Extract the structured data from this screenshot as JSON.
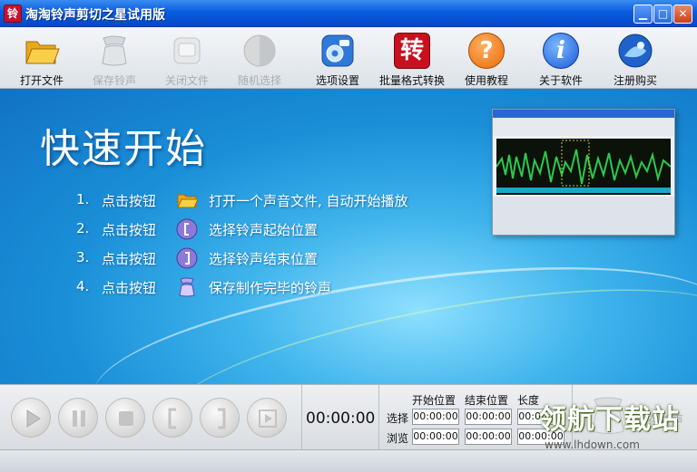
{
  "window": {
    "title": "淘淘铃声剪切之星试用版",
    "app_icon_glyph": "铃",
    "min_glyph": "▁",
    "max_glyph": "□",
    "close_glyph": "✕"
  },
  "toolbar": {
    "items": [
      {
        "label": "打开文件",
        "icon": "folder-open-icon",
        "enabled": true
      },
      {
        "label": "保存铃声",
        "icon": "save-ringtone-icon",
        "enabled": false
      },
      {
        "label": "关闭文件",
        "icon": "close-file-icon",
        "enabled": false
      },
      {
        "label": "随机选择",
        "icon": "random-select-icon",
        "enabled": false
      },
      {
        "label": "选项设置",
        "icon": "settings-icon",
        "enabled": true
      },
      {
        "label": "批量格式转换",
        "icon": "batch-convert-icon",
        "enabled": true,
        "glyph": "转"
      },
      {
        "label": "使用教程",
        "icon": "help-icon",
        "enabled": true,
        "glyph": "?"
      },
      {
        "label": "关于软件",
        "icon": "info-icon",
        "enabled": true,
        "glyph": "i"
      },
      {
        "label": "注册购买",
        "icon": "register-icon",
        "enabled": true
      }
    ]
  },
  "quickstart": {
    "title": "快速开始",
    "steps": [
      {
        "num": "1.",
        "pre": "点击按钮",
        "icon": "folder-open-icon",
        "post": "打开一个声音文件, 自动开始播放"
      },
      {
        "num": "2.",
        "pre": "点击按钮",
        "icon": "set-start-icon",
        "post": "选择铃声起始位置"
      },
      {
        "num": "3.",
        "pre": "点击按钮",
        "icon": "set-end-icon",
        "post": "选择铃声结束位置"
      },
      {
        "num": "4.",
        "pre": "点击按钮",
        "icon": "save-ringtone-icon",
        "post": "保存制作完毕的铃声"
      }
    ]
  },
  "controls": {
    "current_time": "00:00:00",
    "headers": {
      "start": "开始位置",
      "end": "结束位置",
      "length": "长度"
    },
    "rows": [
      {
        "label": "选择",
        "start": "00:00:00",
        "end": "00:00:00",
        "length": "00:00:00"
      },
      {
        "label": "浏览",
        "start": "00:00:00",
        "end": "00:00:00",
        "length": "00:00:00"
      }
    ],
    "save_label": "保存铃声"
  },
  "watermark": {
    "text": "领航下载站",
    "url": "www.lhdown.com"
  },
  "colors": {
    "title_bar": "#0a5ce0",
    "main_bg": "#1a8fd8",
    "disabled_text": "#a9adb2"
  }
}
